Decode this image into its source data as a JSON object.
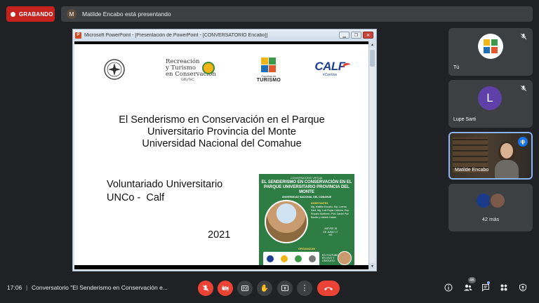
{
  "top": {
    "recording_label": "GRABANDO",
    "presenter_initial": "M",
    "presenting_text": "Matilde Encabo está presentando"
  },
  "ppt": {
    "window_title": "Microsoft PowerPoint - [Presentación de PowerPoint - [CONVERSATORIO Encabo]]",
    "logos": {
      "rec_line1": "Recreación",
      "rec_line2": "y Turismo",
      "rec_line3": "en Conservación",
      "rec_sub": "GRyTeC",
      "fac_line1": "Facultad de",
      "fac_line2": "TURISMO",
      "calf_word": "CALF",
      "calf_tag": "#ConVos"
    },
    "title_lines": [
      "El Senderismo en Conservación en el Parque",
      "Universitario Provincia del Monte",
      "Universidad Nacional del Comahue"
    ],
    "subtitle_lines": [
      "Voluntariado Universitario",
      "UNCo -  Calf"
    ],
    "year": "2021",
    "poster": {
      "top": "CONVERSATORIO VIRTUAL",
      "title": "EL SENDERISMO EN CONSERVACIÓN EN EL PARQUE UNIVERSITARIO PROVINCIA DEL MONTE",
      "university": "UNIVERSIDAD NACIONAL DEL COMAHUE",
      "disertantes_heading": "DISERTANTES",
      "disertantes": "Mg. Matilde Encabo, Mg. Lorena Sarti, Mg. Luis Rojas Cabrera, Esp. Rosario Martínez, Prof. Daniel Paz Basilio y Lisbeth Dasse",
      "date": "JUEVES 16 DE JUNIO 17 HS",
      "organizan": "ORGANIZAN",
      "stream": "EN YOUTUBE EN VIVO Y GRATUITO",
      "colors": {
        "bg": "#2e7d45",
        "accent": "#ffd54f"
      }
    }
  },
  "participants": [
    {
      "name": "Tú",
      "type": "logo",
      "muted": true
    },
    {
      "name": "Lupe Sarti",
      "initial": "L",
      "type": "avatar",
      "color": "#5f3fa8",
      "muted": true
    },
    {
      "name": "Matilde Encabo",
      "type": "video",
      "speaking": true
    },
    {
      "more": "42 más"
    }
  ],
  "bottom": {
    "time": "17:06",
    "divider": "|",
    "meeting_title": "Conversatorio \"El Senderismo en Conservación e...",
    "people_count": "46",
    "controls": [
      "mic-off-icon",
      "camera-off-icon",
      "captions-icon",
      "raise-hand-icon",
      "present-icon",
      "more-options-icon",
      "hang-up-icon"
    ],
    "right_controls": [
      "info-icon",
      "people-icon",
      "chat-icon",
      "activities-icon",
      "host-controls-icon"
    ]
  }
}
